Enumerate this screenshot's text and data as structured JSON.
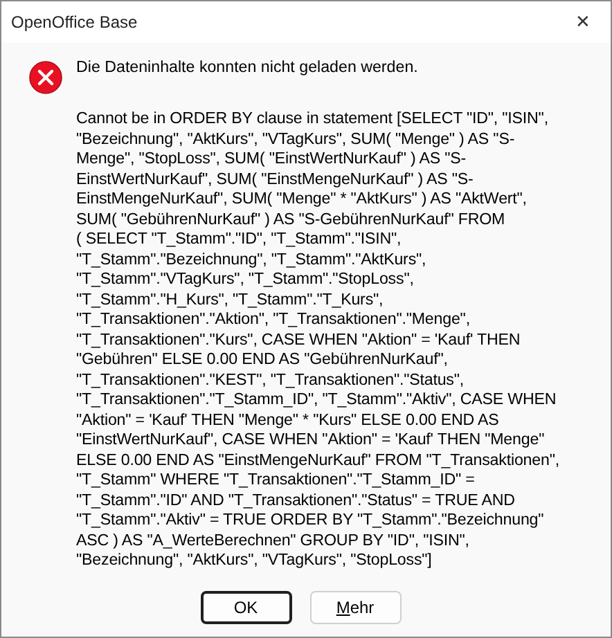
{
  "window": {
    "title": "OpenOffice Base",
    "close": "✕"
  },
  "message": {
    "kind": "error",
    "heading": "Die Dateninhalte konnten nicht geladen werden.",
    "lines": [
      "Cannot be in ORDER BY clause in statement [SELECT \"ID\", \"ISIN\",",
      "\"Bezeichnung\", \"AktKurs\", \"VTagKurs\", SUM( \"Menge\" ) AS \"S-",
      "Menge\", \"StopLoss\", SUM( \"EinstWertNurKauf\" ) AS \"S-",
      "EinstWertNurKauf\", SUM( \"EinstMengeNurKauf\" ) AS \"S-",
      "EinstMengeNurKauf\", SUM( \"Menge\" * \"AktKurs\" ) AS \"AktWert\",",
      "SUM( \"GebührenNurKauf\" ) AS \"S-GebührenNurKauf\" FROM",
      "( SELECT \"T_Stamm\".\"ID\", \"T_Stamm\".\"ISIN\",",
      "\"T_Stamm\".\"Bezeichnung\", \"T_Stamm\".\"AktKurs\",",
      "\"T_Stamm\".\"VTagKurs\", \"T_Stamm\".\"StopLoss\",",
      "\"T_Stamm\".\"H_Kurs\", \"T_Stamm\".\"T_Kurs\",",
      "\"T_Transaktionen\".\"Aktion\", \"T_Transaktionen\".\"Menge\",",
      "\"T_Transaktionen\".\"Kurs\", CASE WHEN \"Aktion\" = 'Kauf' THEN",
      "\"Gebühren\" ELSE 0.00 END AS \"GebührenNurKauf\",",
      "\"T_Transaktionen\".\"KEST\", \"T_Transaktionen\".\"Status\",",
      "\"T_Transaktionen\".\"T_Stamm_ID\", \"T_Stamm\".\"Aktiv\", CASE WHEN",
      "\"Aktion\" = 'Kauf' THEN \"Menge\" * \"Kurs\" ELSE 0.00 END AS",
      "\"EinstWertNurKauf\", CASE WHEN \"Aktion\" = 'Kauf' THEN \"Menge\"",
      "ELSE 0.00 END AS \"EinstMengeNurKauf\" FROM \"T_Transaktionen\",",
      "\"T_Stamm\" WHERE \"T_Transaktionen\".\"T_Stamm_ID\" =",
      "\"T_Stamm\".\"ID\" AND \"T_Transaktionen\".\"Status\" = TRUE AND",
      "\"T_Stamm\".\"Aktiv\" = TRUE ORDER BY \"T_Stamm\".\"Bezeichnung\"",
      "ASC ) AS \"A_WerteBerechnen\" GROUP BY \"ID\", \"ISIN\",",
      "\"Bezeichnung\", \"AktKurs\", \"VTagKurs\", \"StopLoss\"]"
    ]
  },
  "buttons": [
    {
      "label": "OK",
      "default": true
    },
    {
      "label": "Mehr",
      "default": false
    }
  ]
}
